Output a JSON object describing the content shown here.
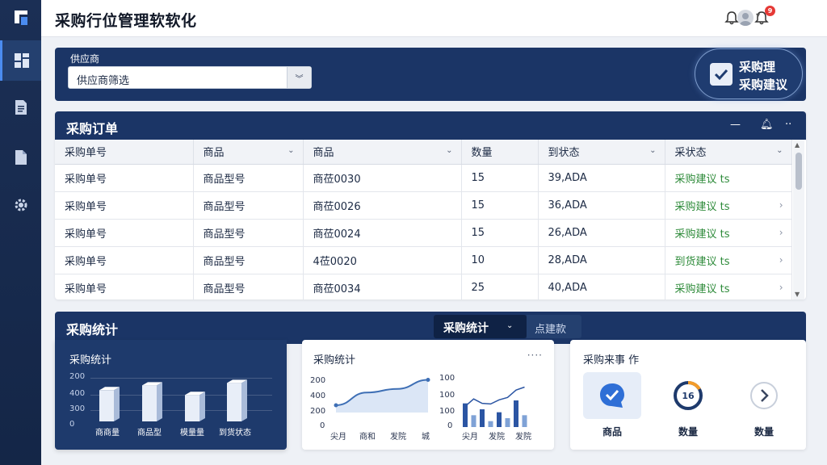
{
  "app": {
    "title": "采购行位管理软软化"
  },
  "topbar": {
    "notification_count": "9"
  },
  "supplier": {
    "label": "供应商",
    "select_value": "供应商筛选",
    "suggest_line1": "采购理",
    "suggest_line2": "采购建议"
  },
  "orders": {
    "title": "采购订单",
    "columns": [
      "采购单号",
      "商品",
      "商品",
      "数量",
      "到状态",
      "采状态"
    ],
    "rows": [
      [
        "采购单号",
        "商品型号",
        "商莅0030",
        "15",
        "39,ADA",
        "采购建议 ts"
      ],
      [
        "采购单号",
        "商品型号",
        "商莅0026",
        "15",
        "36,ADA",
        "采购建议 ts"
      ],
      [
        "采购单号",
        "商品型号",
        "商莅0024",
        "15",
        "26,ADA",
        "采购建议 ts"
      ],
      [
        "采购单号",
        "商品型号",
        "4莅0020",
        "10",
        "28,ADA",
        "到货建议 ts"
      ],
      [
        "采购单号",
        "商品型号",
        "商莅0034",
        "25",
        "40,ADA",
        "采购建议 ts"
      ]
    ]
  },
  "stats": {
    "title": "采购统计",
    "dropdown_value": "采购统计",
    "tab_label": "点建款"
  },
  "card_dark": {
    "title": "采购统计",
    "ticks": [
      "200",
      "400",
      "300",
      "0"
    ],
    "categories": [
      "商商量",
      "商品型",
      "模量量",
      "到货状态"
    ]
  },
  "card_charts": {
    "title": "采购统计",
    "dots": "····",
    "line_ticks": [
      "200",
      "400",
      "200",
      "0"
    ],
    "line_categories": [
      "尖月",
      "商和",
      "发院",
      "城"
    ],
    "bar_ticks": [
      "100",
      "100",
      "100",
      "0"
    ],
    "bar_categories": [
      "尖月",
      "发院",
      "发院"
    ]
  },
  "card_actions": {
    "title": "采购来事 作",
    "items": [
      {
        "label": "商品",
        "icon": "check-circle-icon"
      },
      {
        "label": "数量",
        "icon": "progress-ring-icon",
        "ring_text": "16"
      },
      {
        "label": "数量",
        "icon": "chevron-right-circle-icon"
      }
    ]
  },
  "chart_data": [
    {
      "type": "bar",
      "title": "采购统计",
      "categories": [
        "商商量",
        "商品型",
        "模量量",
        "到货状态"
      ],
      "values": [
        260,
        300,
        220,
        320
      ],
      "ylim": [
        0,
        500
      ]
    },
    {
      "type": "area",
      "title": "采购统计",
      "categories": [
        "尖月",
        "商和",
        "发院",
        "城"
      ],
      "values": [
        40,
        110,
        130,
        180
      ],
      "ylim": [
        0,
        400
      ]
    },
    {
      "type": "bar",
      "categories": [
        "尖月",
        "发院",
        "发院"
      ],
      "values": [
        80,
        40,
        60,
        20,
        50,
        30,
        90,
        40
      ],
      "line_values": [
        70,
        95,
        80,
        78,
        92,
        100,
        125,
        135
      ],
      "ylim": [
        0,
        150
      ]
    }
  ],
  "colors": {
    "navy": "#1b3566",
    "accent": "#4b8cf0",
    "status_green": "#2e8b3a"
  }
}
